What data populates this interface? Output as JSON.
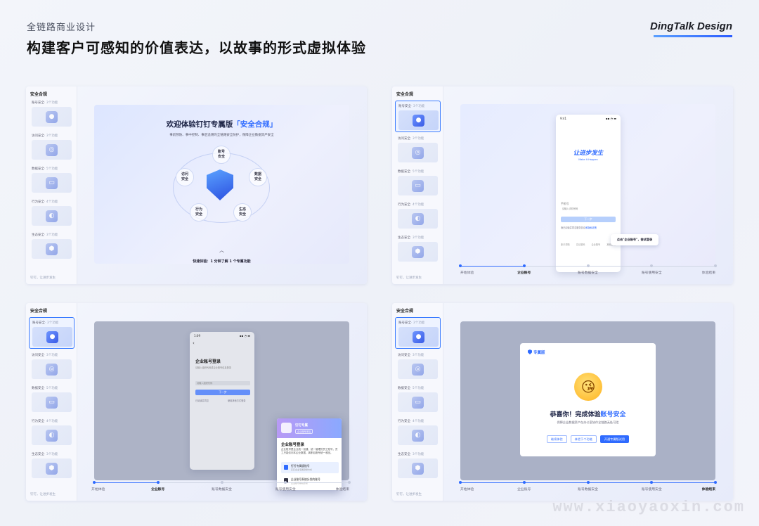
{
  "header": {
    "subtitle": "全链路商业设计",
    "title": "构建客户可感知的价值表达，以故事的形式虚拟体验",
    "brand": "DingTalk Design"
  },
  "sidebar": {
    "title": "安全合规",
    "items": [
      {
        "label": "账号安全",
        "count": "· 3个功能"
      },
      {
        "label": "访问安全",
        "count": "· 3个功能"
      },
      {
        "label": "数据安全",
        "count": "· 5个功能"
      },
      {
        "label": "行为安全",
        "count": "· 4个功能"
      },
      {
        "label": "生态安全",
        "count": "· 3个功能"
      }
    ],
    "footer": "钉钉，让进步发生"
  },
  "panel1": {
    "title_pre": "欢迎体验钉钉专属版",
    "title_hl": "「安全合规」",
    "subtitle": "事前预防、事中控制、事后追溯的全链路安全防护，保障企业数据资产安全",
    "nodes": {
      "account": "账号\n安全",
      "access": "访问\n安全",
      "data": "数据\n安全",
      "behavior": "行为\n安全",
      "eco": "生态\n安全"
    },
    "chevron": "︿",
    "quick": "快速体验：1 分钟了解 1 个专属功能"
  },
  "timeline": {
    "steps": [
      "开始体验",
      "企业账号",
      "账号数据安全",
      "账号使用安全",
      "体验结束"
    ]
  },
  "panel2": {
    "time": "9:41",
    "status": "▪▪ ◔ ▬",
    "slogan": "让进步发生",
    "slogan_en": "Make It Happen",
    "phone_label": "手机号",
    "phone_placeholder": "请输入手机号码",
    "next": "下一步",
    "agree": "我已阅读并同意服务协议",
    "agree_link": "和隐私政策",
    "foot": [
      "新手帮助",
      "忘记密码",
      "企业账号",
      "其他登录"
    ],
    "tip": "点击\"企业账号\"，尝试登录"
  },
  "panel3": {
    "time": "1:09",
    "status": "▪▪ ◔ ▬",
    "back": "‹",
    "title": "企业账号登录",
    "subtitle": "请输入组织代码或企业账号信息登录",
    "field": "请输入组织代码",
    "btn": "下一步",
    "agree": "已阅读并同意",
    "link": "使用其他方式登录",
    "pop": {
      "name": "钉钉专属",
      "tag": "企业账号体验",
      "title": "企业账号登录",
      "desc": "企业账号是企业统一创建、统一管理的员工账号，员工只能访问本企业数据，离职后账号统一收回。",
      "opt1": "钉钉专属版账号",
      "opt1_sub": "钉钉企业专属登录方式",
      "opt2": "企业账号系统分发的账号",
      "opt2_sub": "企业账号系统登录"
    }
  },
  "panel4": {
    "logo": "专属版",
    "emoji": "😘",
    "title_pre": "恭喜你！完成体验",
    "title_hl": "账号安全",
    "subtitle": "保障企业数据资产在办公室协作全链路无处可泄",
    "btns": [
      "继续体验",
      "体验下个功能",
      "开通专属版试用"
    ]
  },
  "watermark": "www.xiaoyaoxin.com"
}
